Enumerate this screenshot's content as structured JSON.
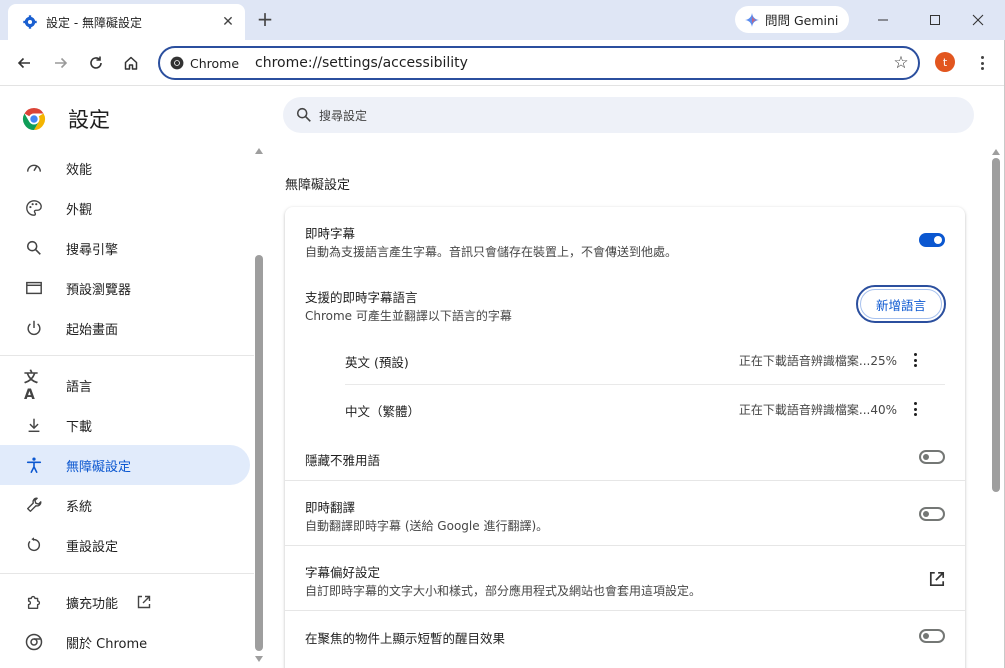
{
  "tab": {
    "title": "設定 - 無障礙設定",
    "favicon": "gear-icon",
    "close": "✕"
  },
  "new_tab": "+",
  "gemini": {
    "label": "問問 Gemini",
    "icon": "gemini-sparkle-icon"
  },
  "window_controls": [
    "minimize-icon",
    "maximize-icon",
    "close-icon"
  ],
  "toolbar": {
    "chip_label": "Chrome",
    "url": "chrome://settings/accessibility",
    "avatar_initial": "t",
    "avatar_color": "#e2561f"
  },
  "sidebar": {
    "title": "設定",
    "items": [
      {
        "label": "效能",
        "icon": "speedometer-icon"
      },
      {
        "label": "外觀",
        "icon": "palette-icon"
      },
      {
        "label": "搜尋引擎",
        "icon": "search-icon"
      },
      {
        "label": "預設瀏覽器",
        "icon": "browser-window-icon"
      },
      {
        "label": "起始畫面",
        "icon": "power-icon"
      },
      {
        "label": "語言",
        "icon": "translate-icon"
      },
      {
        "label": "下載",
        "icon": "download-icon"
      },
      {
        "label": "無障礙設定",
        "icon": "accessibility-icon",
        "active": true
      },
      {
        "label": "系統",
        "icon": "wrench-icon"
      },
      {
        "label": "重設設定",
        "icon": "reset-icon"
      },
      {
        "label": "擴充功能",
        "icon": "puzzle-icon"
      },
      {
        "label": "關於 Chrome",
        "icon": "chrome-icon"
      }
    ]
  },
  "search": {
    "placeholder": "搜尋設定"
  },
  "section_title": "無障礙設定",
  "settings": {
    "live_caption": {
      "title": "即時字幕",
      "desc": "自動為支援語言產生字幕。音訊只會儲存在裝置上，不會傳送到他處。",
      "enabled": true
    },
    "caption_langs": {
      "title": "支援的即時字幕語言",
      "desc": "Chrome 可產生並翻譯以下語言的字幕",
      "add_button": "新增語言",
      "languages": [
        {
          "name": "英文 (預設)",
          "status": "正在下載語音辨識檔案...25%"
        },
        {
          "name": "中文（繁體）",
          "status": "正在下載語音辨識檔案...40%"
        }
      ]
    },
    "hide_profanity": {
      "title": "隱藏不雅用語",
      "enabled": false
    },
    "live_translate": {
      "title": "即時翻譯",
      "desc": "自動翻譯即時字幕 (送給 Google 進行翻譯)。",
      "enabled": false
    },
    "caption_prefs": {
      "title": "字幕偏好設定",
      "desc": "自訂即時字幕的文字大小和樣式，部分應用程式及網站也會套用這項設定。"
    },
    "focus_highlight": {
      "title": "在聚焦的物件上顯示短暫的醒目效果",
      "enabled": false
    }
  },
  "colors": {
    "accent": "#0b57d0",
    "active_bg": "#e1ebfb",
    "titlebar": "#dfe6f5"
  }
}
